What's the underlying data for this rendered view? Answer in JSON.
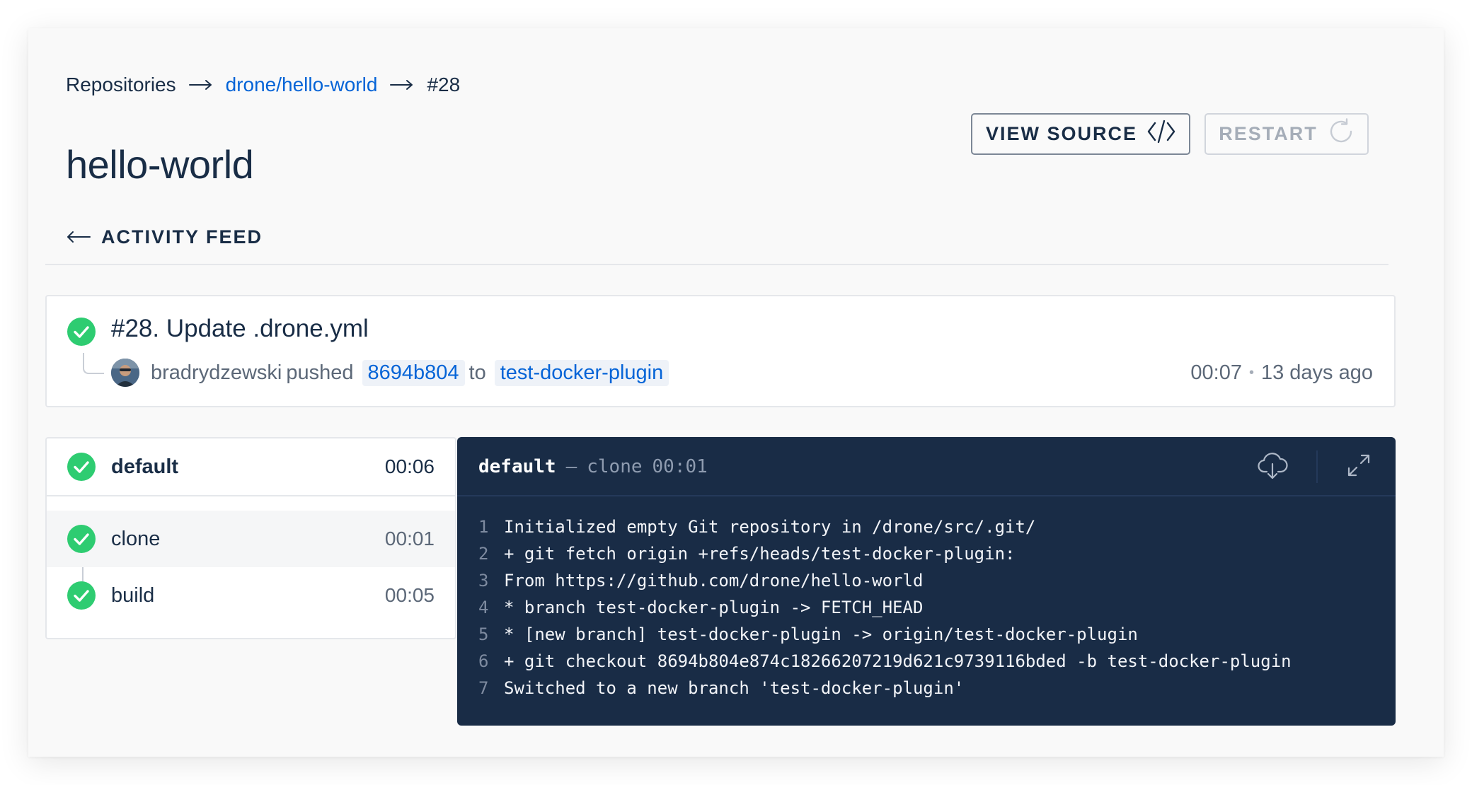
{
  "breadcrumb": {
    "repositories": "Repositories",
    "repo": "drone/hello-world",
    "build": "#28"
  },
  "page": {
    "title": "hello-world"
  },
  "actions": {
    "view_source": "VIEW SOURCE",
    "restart": "RESTART"
  },
  "nav": {
    "activity_feed": "ACTIVITY FEED"
  },
  "build": {
    "title": "#28. Update .drone.yml",
    "author": "bradrydzewski",
    "action": "pushed",
    "commit": "8694b804",
    "to": "to",
    "branch": "test-docker-plugin",
    "duration": "00:07",
    "dot": "•",
    "age": "13 days ago",
    "status": "success"
  },
  "stage": {
    "name": "default",
    "duration": "00:06",
    "steps": [
      {
        "name": "clone",
        "duration": "00:01"
      },
      {
        "name": "build",
        "duration": "00:05"
      }
    ]
  },
  "log": {
    "stage": "default",
    "dash": "—",
    "step": "clone",
    "duration": "00:01",
    "lines": [
      {
        "n": "1",
        "text": "Initialized empty Git repository in /drone/src/.git/"
      },
      {
        "n": "2",
        "text": "+ git fetch origin +refs/heads/test-docker-plugin:"
      },
      {
        "n": "3",
        "text": "From https://github.com/drone/hello-world"
      },
      {
        "n": "4",
        "text": "* branch test-docker-plugin -> FETCH_HEAD"
      },
      {
        "n": "5",
        "text": "* [new branch] test-docker-plugin -> origin/test-docker-plugin"
      },
      {
        "n": "6",
        "text": "+ git checkout 8694b804e874c18266207219d621c9739116bded -b test-docker-plugin"
      },
      {
        "n": "7",
        "text": "Switched to a new branch 'test-docker-plugin'"
      }
    ]
  },
  "colors": {
    "success": "#2ecc71",
    "link": "#0564d7",
    "log_bg": "#192c46"
  },
  "icons": {
    "arrow": "arrow-right-icon",
    "back": "arrow-left-icon",
    "code": "code-icon",
    "restart": "refresh-icon",
    "check": "check-circle-icon",
    "download": "download-cloud-icon",
    "expand": "expand-icon"
  }
}
